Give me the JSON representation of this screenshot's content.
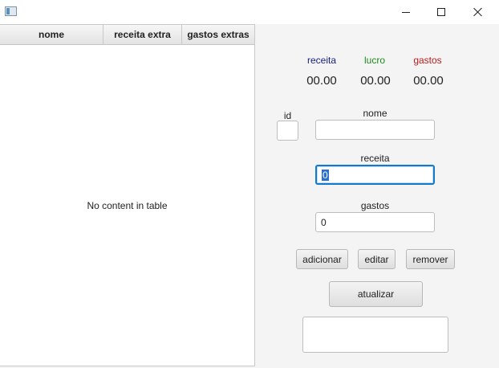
{
  "window": {
    "icons": {
      "app": "app-icon",
      "minimize": "minimize-icon",
      "maximize": "maximize-icon",
      "close": "close-icon"
    }
  },
  "table": {
    "columns": [
      "nome",
      "receita extra",
      "gastos extras"
    ],
    "placeholder": "No content in table"
  },
  "summary": {
    "receita": {
      "label": "receita",
      "value": "00.00",
      "color": "#1a237e"
    },
    "lucro": {
      "label": "lucro",
      "value": "00.00",
      "color": "#1b8a1b"
    },
    "gastos": {
      "label": "gastos",
      "value": "00.00",
      "color": "#b71c1c"
    }
  },
  "form": {
    "id_label": "id",
    "id_value": "",
    "nome_label": "nome",
    "nome_value": "",
    "receita_label": "receita",
    "receita_value": "0",
    "gastos_label": "gastos",
    "gastos_value": "0"
  },
  "buttons": {
    "adicionar": "adicionar",
    "editar": "editar",
    "remover": "remover",
    "atualizar": "atualizar"
  },
  "output_text": ""
}
